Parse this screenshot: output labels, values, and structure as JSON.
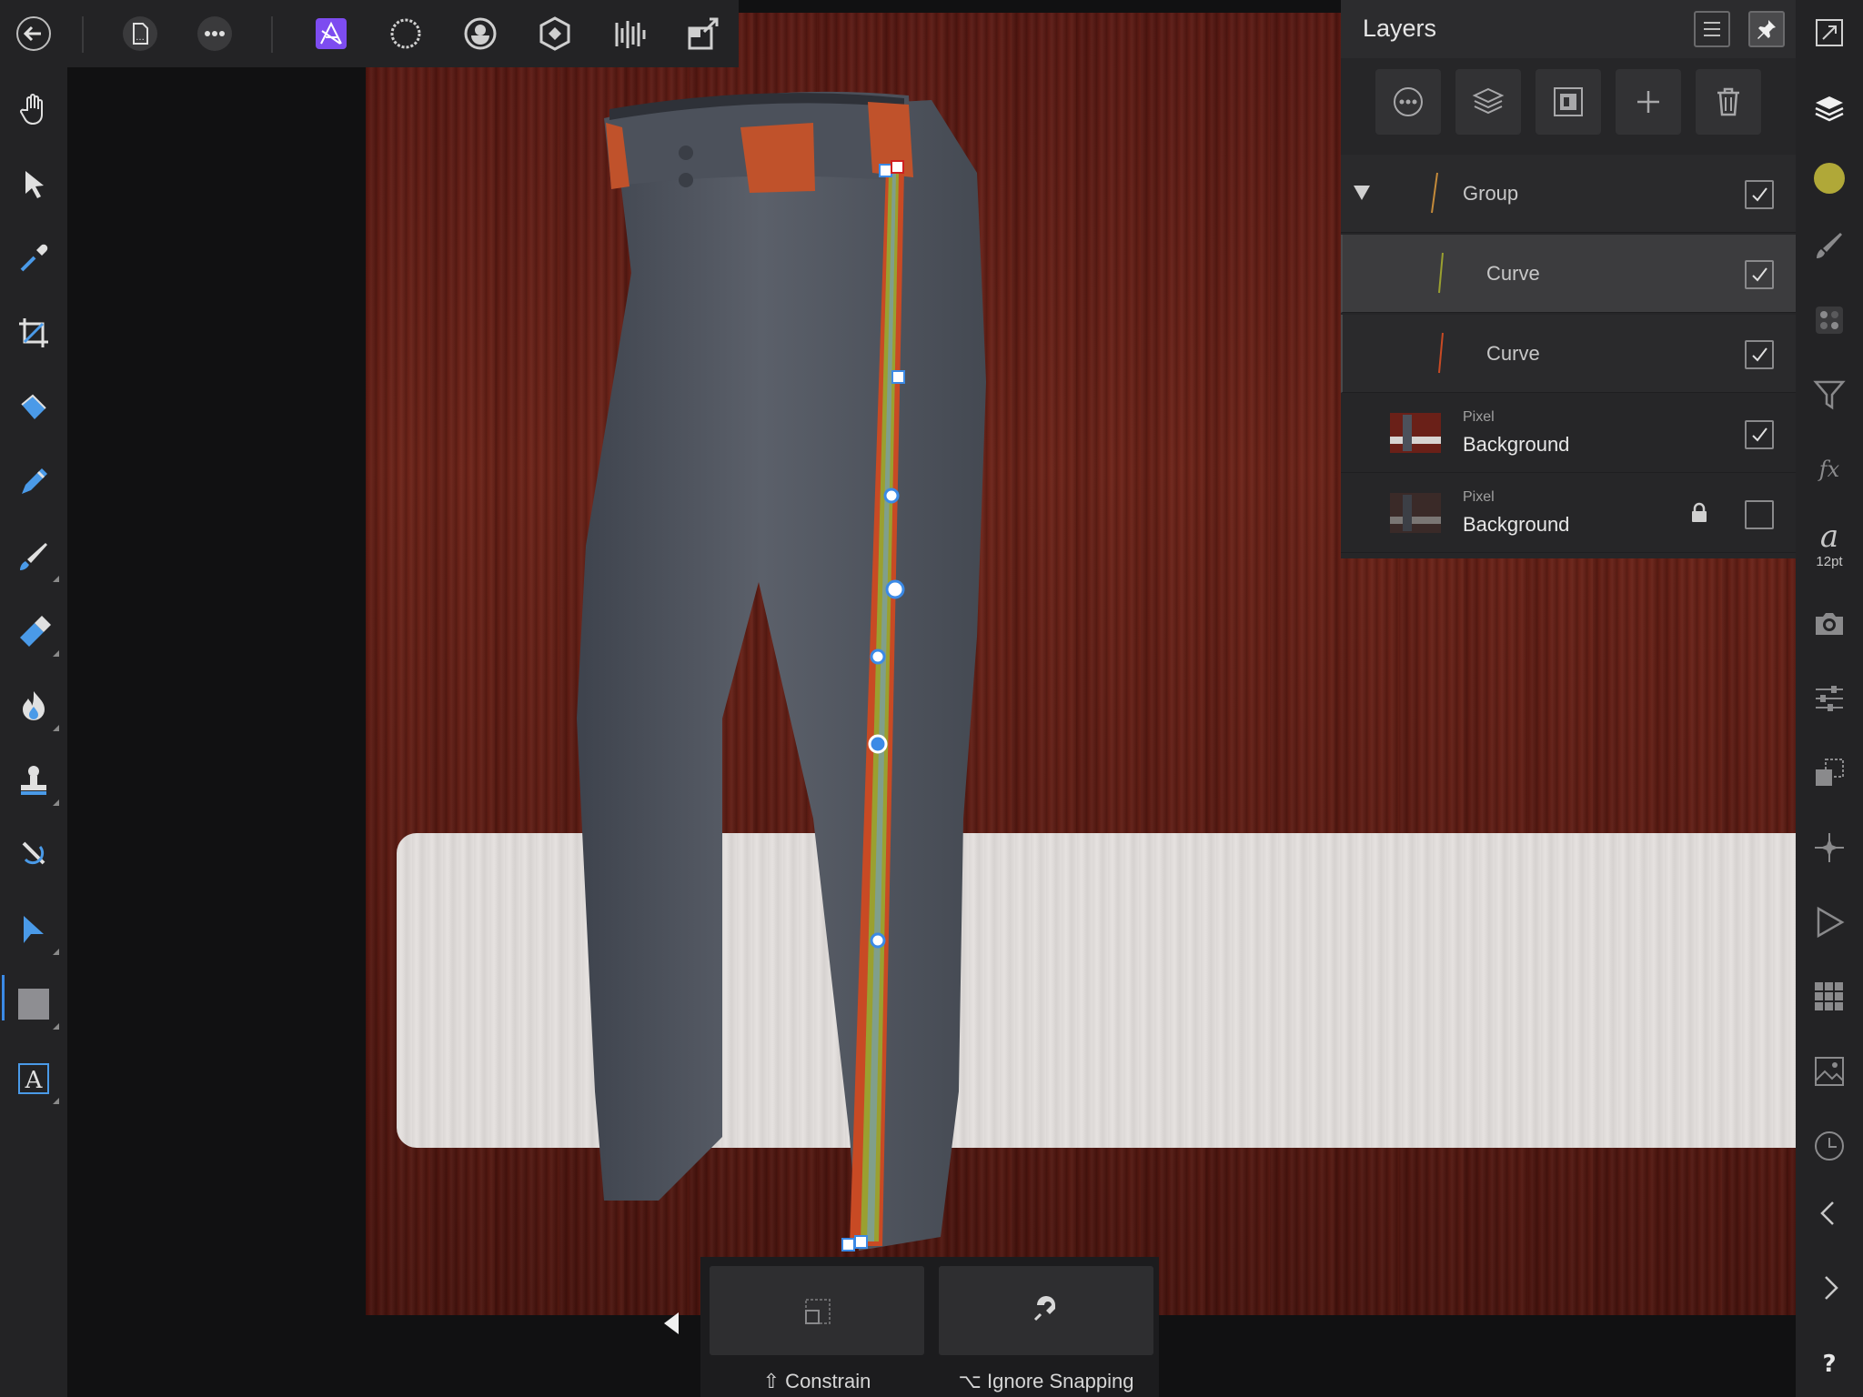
{
  "topbar": {
    "items": [
      {
        "name": "back-icon"
      },
      {
        "name": "document-icon"
      },
      {
        "name": "more-icon"
      },
      {
        "name": "photo-persona-icon"
      },
      {
        "name": "liquify-persona-icon"
      },
      {
        "name": "develop-persona-icon"
      },
      {
        "name": "tone-mapping-persona-icon"
      },
      {
        "name": "export-persona-icon"
      },
      {
        "name": "share-icon"
      }
    ]
  },
  "left_tools": [
    "hand-tool-icon",
    "move-tool-icon",
    "color-picker-tool-icon",
    "crop-tool-icon",
    "flood-fill-tool-icon",
    "selection-brush-tool-icon",
    "paint-brush-tool-icon",
    "erase-brush-tool-icon",
    "dodge-brush-tool-icon",
    "clone-brush-tool-icon",
    "blemish-removal-tool-icon",
    "node-tool-icon",
    "rectangle-tool-icon",
    "text-tool-icon"
  ],
  "selected_tool": "node-tool-icon",
  "context_bar": {
    "constrain_label": "⇧ Constrain",
    "ignore_snapping_label": "⌥ Ignore Snapping"
  },
  "layers_panel": {
    "title": "Layers",
    "layers": [
      {
        "name": "Group",
        "type": "",
        "checked": true,
        "expanded": true,
        "locked": false,
        "indent": 0
      },
      {
        "name": "Curve",
        "type": "",
        "checked": true,
        "locked": false,
        "indent": 1,
        "selected": true
      },
      {
        "name": "Curve",
        "type": "",
        "checked": true,
        "locked": false,
        "indent": 1
      },
      {
        "name": "Background",
        "type": "Pixel",
        "checked": true,
        "locked": false,
        "indent": 0
      },
      {
        "name": "Background",
        "type": "Pixel",
        "checked": false,
        "locked": true,
        "indent": 0
      }
    ]
  },
  "right_studio": {
    "text_size": "12pt",
    "color_swatch": "#b0a838"
  },
  "colors": {
    "accent": "#3b8ae6",
    "persona_active": "#7d4cf0",
    "stripe_orange": "#c84a24",
    "stripe_olive": "#9aa030"
  }
}
